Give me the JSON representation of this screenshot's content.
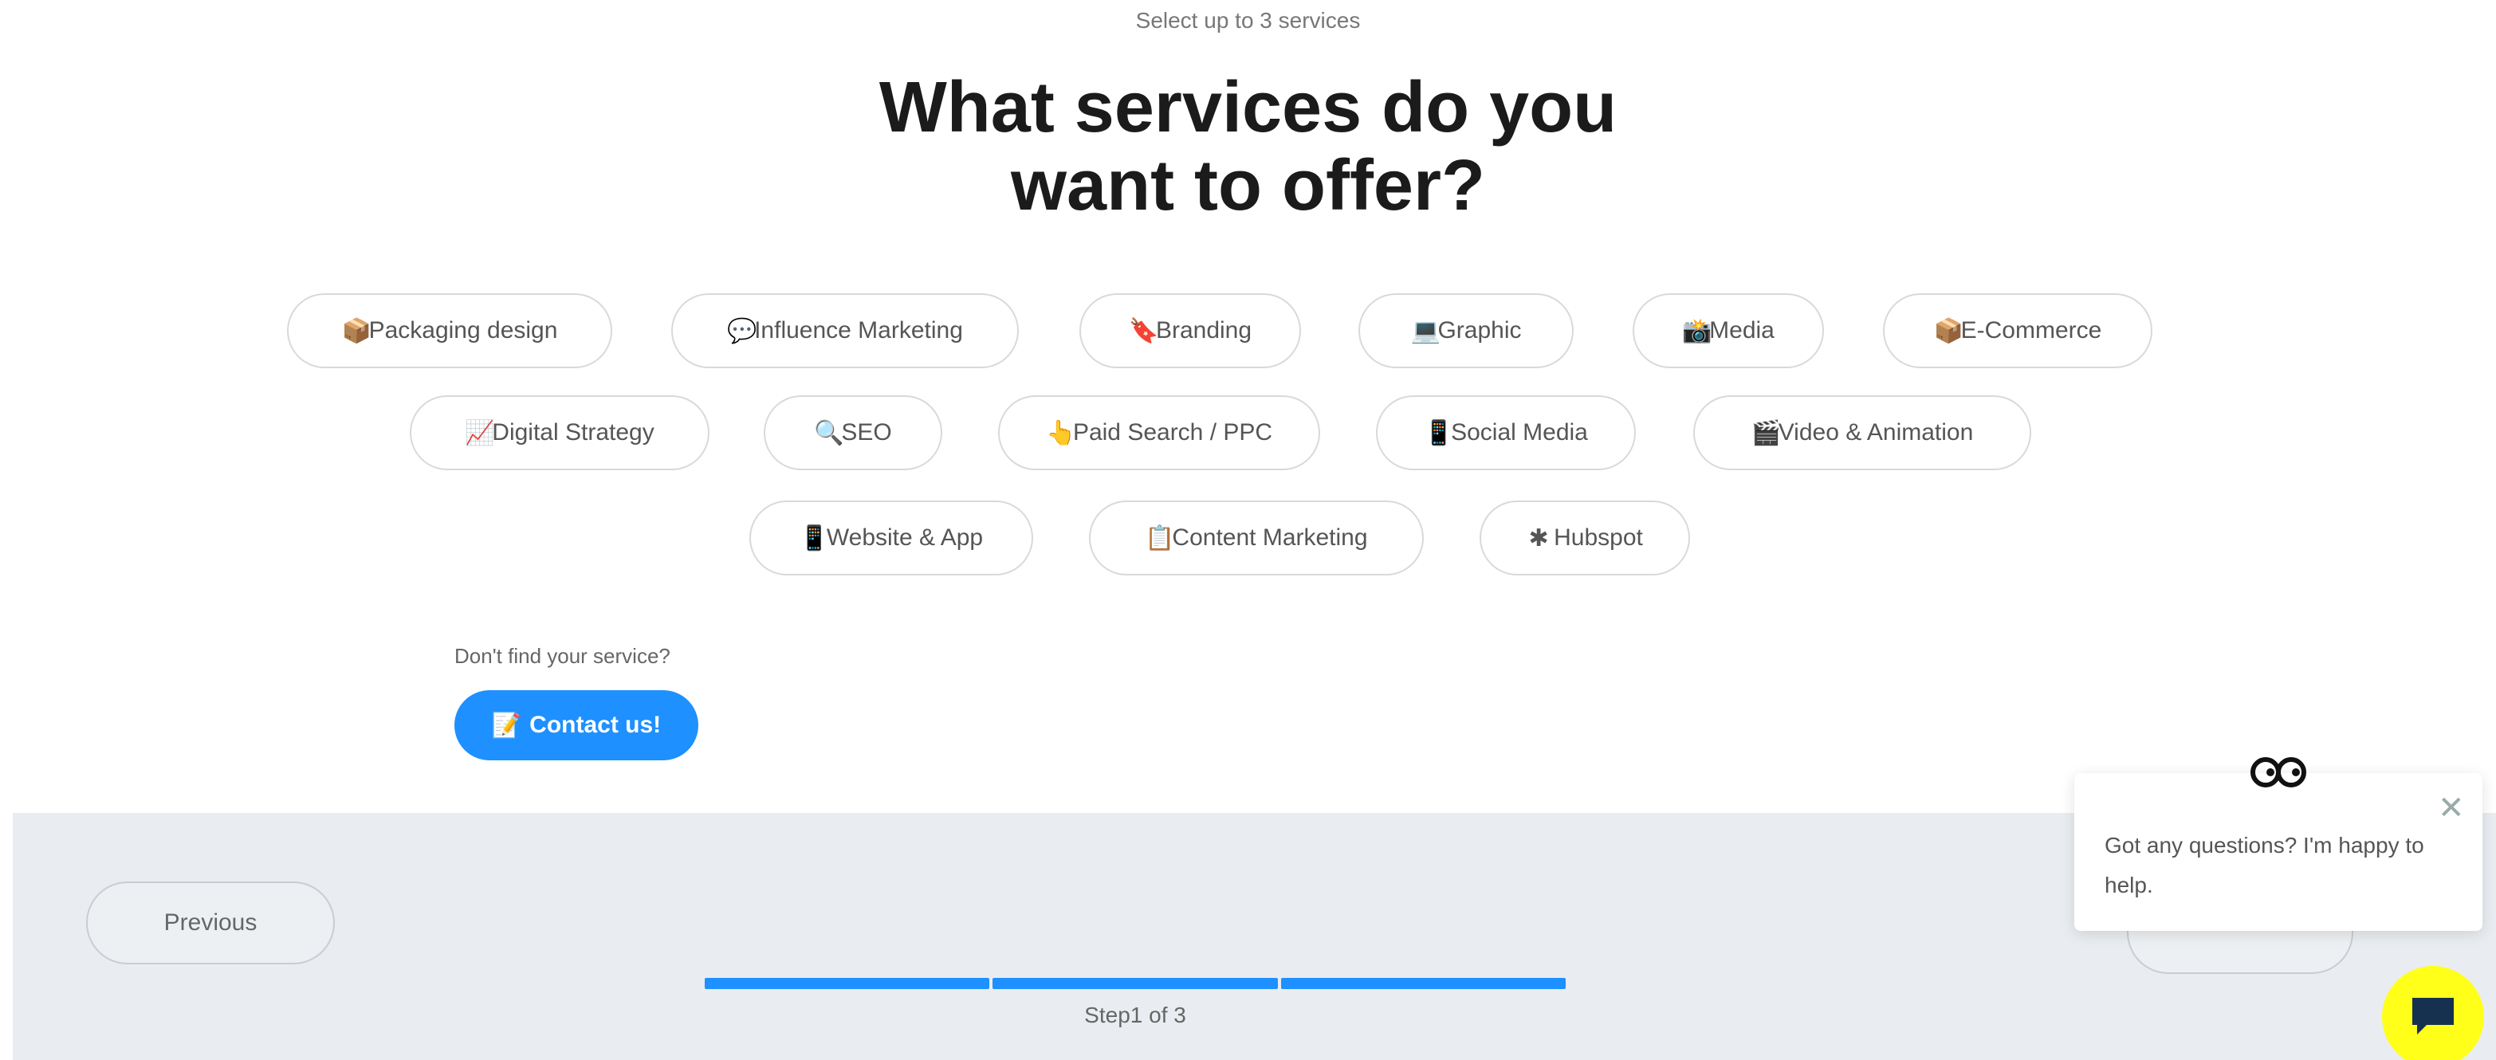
{
  "header": {
    "hint": "Select up to 3 services",
    "title_line1": "What services do you",
    "title_line2": "want to offer?"
  },
  "services": [
    {
      "icon": "📦",
      "label": "Packaging design"
    },
    {
      "icon": "💬",
      "label": "Influence Marketing"
    },
    {
      "icon": "🔖",
      "label": "Branding"
    },
    {
      "icon": "💻",
      "label": "Graphic"
    },
    {
      "icon": "📸",
      "label": "Media"
    },
    {
      "icon": "📦",
      "label": "E-Commerce"
    },
    {
      "icon": "📈",
      "label": "Digital Strategy"
    },
    {
      "icon": "🔍",
      "label": "SEO"
    },
    {
      "icon": "👆",
      "label": "Paid Search / PPC"
    },
    {
      "icon": "📱",
      "label": "Social Media"
    },
    {
      "icon": "🎬",
      "label": "Video & Animation"
    },
    {
      "icon": "📱",
      "label": "Website & App"
    },
    {
      "icon": "📋",
      "label": "Content Marketing"
    },
    {
      "icon": "✱",
      "label": "Hubspot"
    }
  ],
  "contact": {
    "prompt": "Don't find your service?",
    "button_icon": "📝",
    "button_label": "Contact us!"
  },
  "footer": {
    "previous_label": "Previous",
    "step_label": "Step1 of 3",
    "progress": {
      "current": 1,
      "total": 3
    }
  },
  "chat": {
    "close_glyph": "✕",
    "message": "Got any questions? I'm happy to help."
  },
  "colors": {
    "accent": "#1e90ff",
    "footer_bg": "#e9edf1",
    "chat_fab": "#ffff1a"
  }
}
